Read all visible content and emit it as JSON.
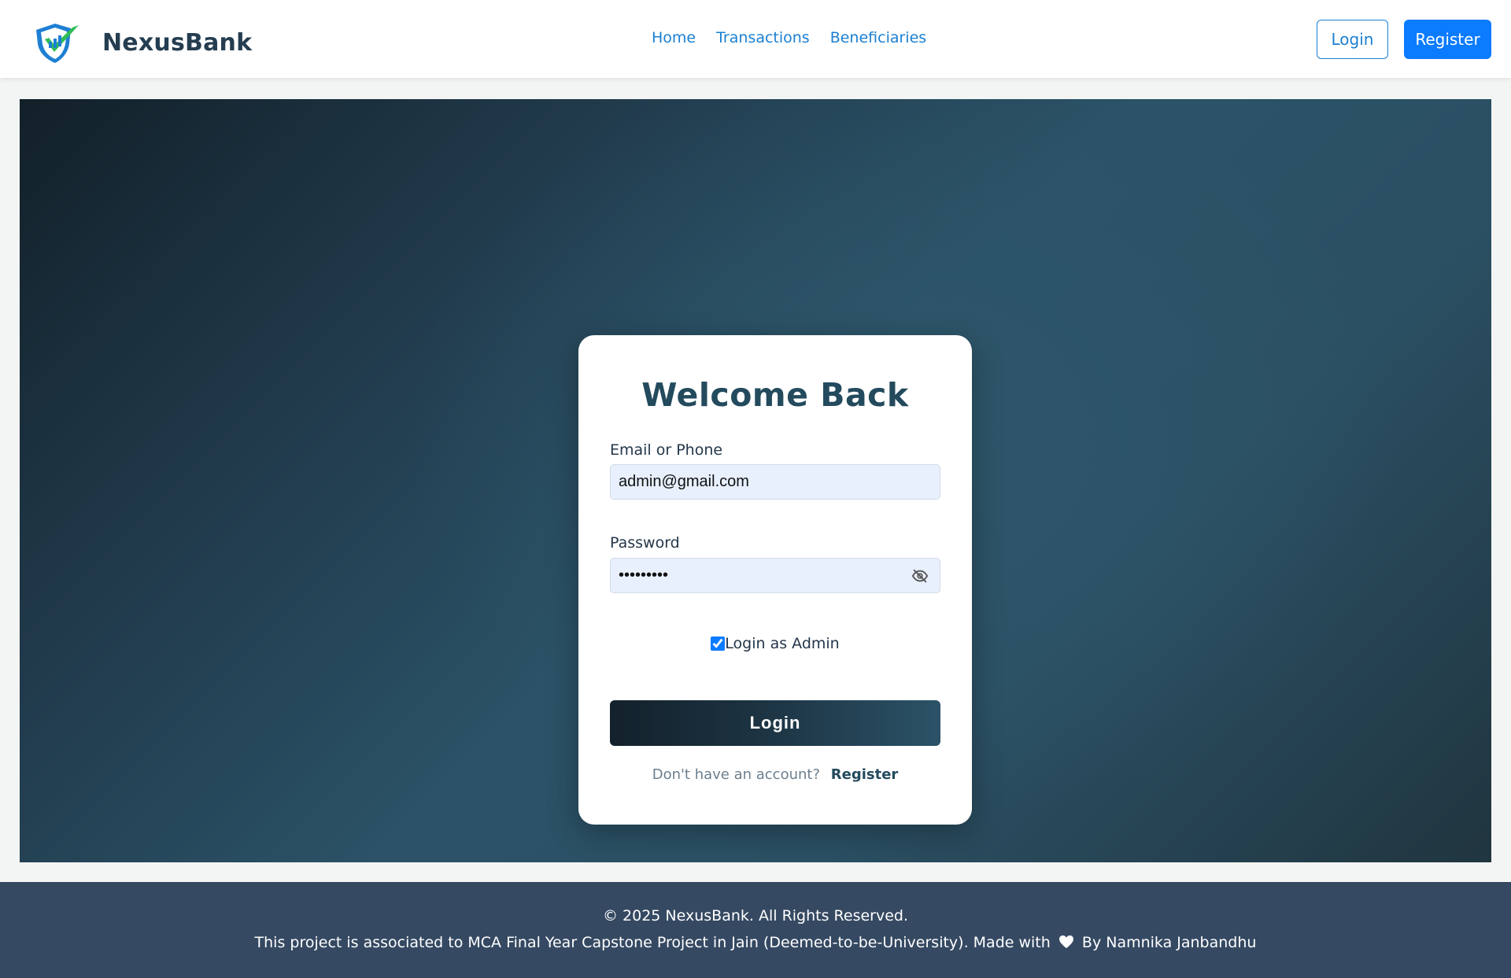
{
  "brand": {
    "name": "NexusBank",
    "logo_icon": "shield-check-icon"
  },
  "nav": {
    "links": [
      "Home",
      "Transactions",
      "Beneficiaries"
    ],
    "login_label": "Login",
    "register_label": "Register"
  },
  "login_form": {
    "title": "Welcome Back",
    "email_label": "Email or Phone",
    "email_value": "admin@gmail.com",
    "password_label": "Password",
    "password_value": "password1",
    "password_toggle_icon": "eye-off-icon",
    "admin_checkbox_label": "Login as Admin",
    "admin_checked": true,
    "submit_label": "Login",
    "no_account_text": "Don't have an account?",
    "register_link": "Register"
  },
  "footer": {
    "copyright": "© 2025 NexusBank. All Rights Reserved.",
    "project_text_before": "This project is associated to MCA Final Year Capstone Project in Jain (Deemed-to-be-University). Made with",
    "project_text_after": "By Namnika Janbandhu",
    "heart_icon": "heart-icon"
  },
  "colors": {
    "brand_text": "#253d50",
    "link_blue": "#1b7fd1",
    "primary_button": "#0b7bff",
    "hero_dark": "#122029",
    "hero_mid": "#2b5267",
    "card_title": "#234a5d",
    "footer_bg": "#354962"
  }
}
